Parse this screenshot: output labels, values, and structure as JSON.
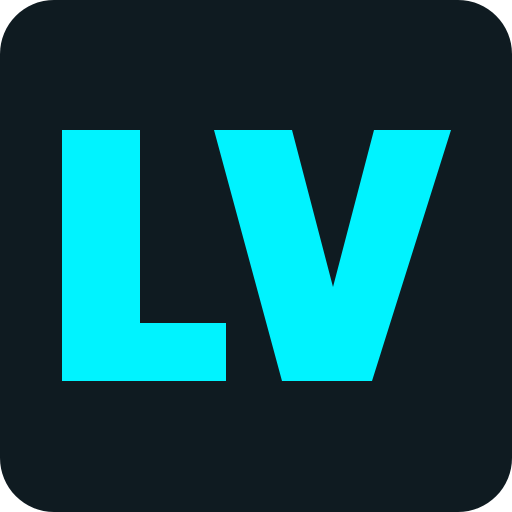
{
  "icon": {
    "logo_text": "LV",
    "background_color": "#0f1b21",
    "accent_color": "#00f3ff"
  }
}
